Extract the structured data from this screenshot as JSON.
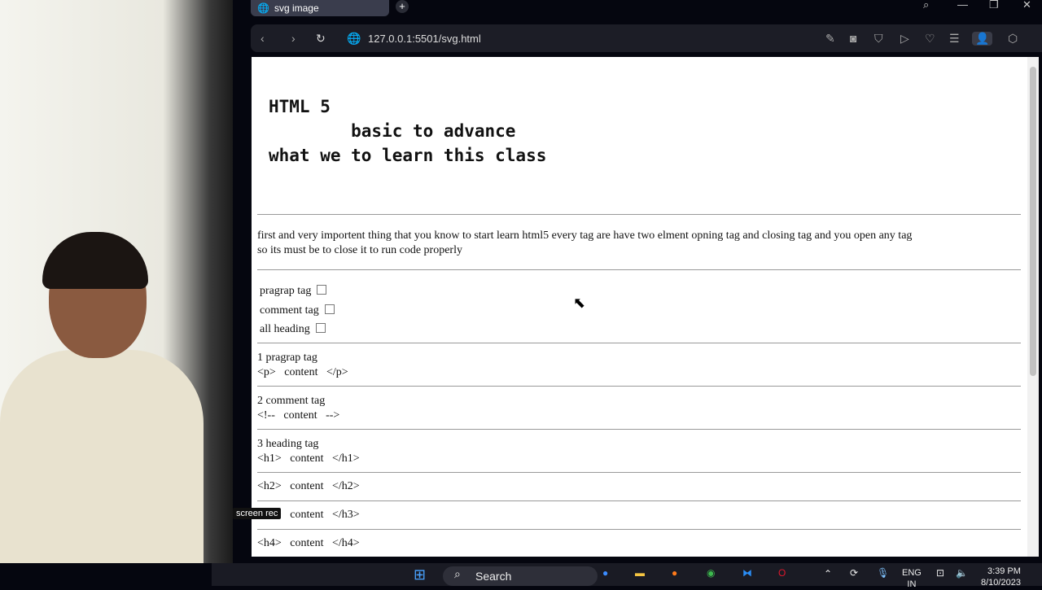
{
  "browser": {
    "tab_title": "svg image",
    "new_tab": "+",
    "url": "127.0.0.1:5501/svg.html"
  },
  "page": {
    "heading": "HTML 5\n        basic to advance\nwhat we to learn this class",
    "intro_line1": "first and very importent thing that you know to start learn html5 every tag are have two elment opning tag and closing tag and you open any tag",
    "intro_line2": "so its must be to close it to run code properly",
    "checkboxes": [
      {
        "label": "pragrap tag",
        "checked": false
      },
      {
        "label": "comment tag",
        "checked": false
      },
      {
        "label": "all heading",
        "checked": false
      }
    ],
    "sections": [
      {
        "title": "1 pragrap tag",
        "code": "<p>   content   </p>"
      },
      {
        "title": "2 comment tag",
        "code": "<!--   content   -->"
      },
      {
        "title": "3 heading tag",
        "code": "<h1>   content   </h1>"
      }
    ],
    "extra_codes": [
      "<h2>   content   </h2>",
      "<h3>   content   </h3>",
      "<h4>   content   </h4>"
    ]
  },
  "overlay": {
    "screenrec": "screen rec"
  },
  "taskbar": {
    "search": "Search",
    "lang": "ENG",
    "region": "IN",
    "time": "3:39 PM",
    "date": "8/10/2023"
  }
}
